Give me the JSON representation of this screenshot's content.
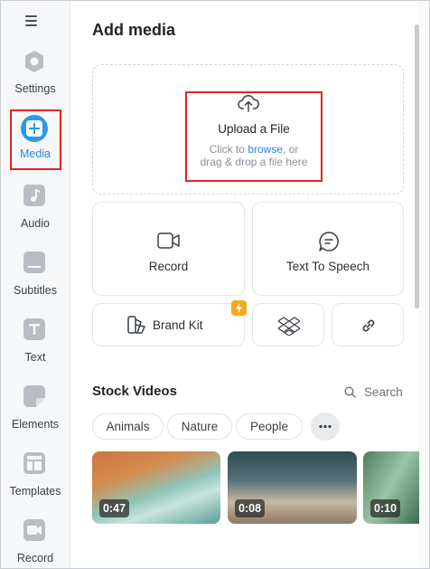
{
  "sidebar": {
    "items": [
      {
        "label": "Settings"
      },
      {
        "label": "Media"
      },
      {
        "label": "Audio"
      },
      {
        "label": "Subtitles"
      },
      {
        "label": "Text"
      },
      {
        "label": "Elements"
      },
      {
        "label": "Templates"
      },
      {
        "label": "Record"
      }
    ],
    "active": "Media",
    "accent": "#2a9af0"
  },
  "main": {
    "title": "Add media",
    "upload": {
      "title": "Upload a File",
      "sub_prefix": "Click to ",
      "sub_link": "browse",
      "sub_suffix": ", or",
      "sub_line2": "drag & drop a file here"
    },
    "actions": {
      "record": "Record",
      "tts": "Text To Speech",
      "brand_kit": "Brand Kit"
    },
    "stock": {
      "title": "Stock Videos",
      "search_label": "Search",
      "chips": [
        "Animals",
        "Nature",
        "People"
      ],
      "videos": [
        {
          "duration": "0:47"
        },
        {
          "duration": "0:08"
        },
        {
          "duration": "0:10"
        }
      ]
    }
  },
  "colors": {
    "highlight": "#e02424",
    "accent": "#2a9af0",
    "link": "#2a8ae0",
    "bolt": "#f5a81c"
  }
}
